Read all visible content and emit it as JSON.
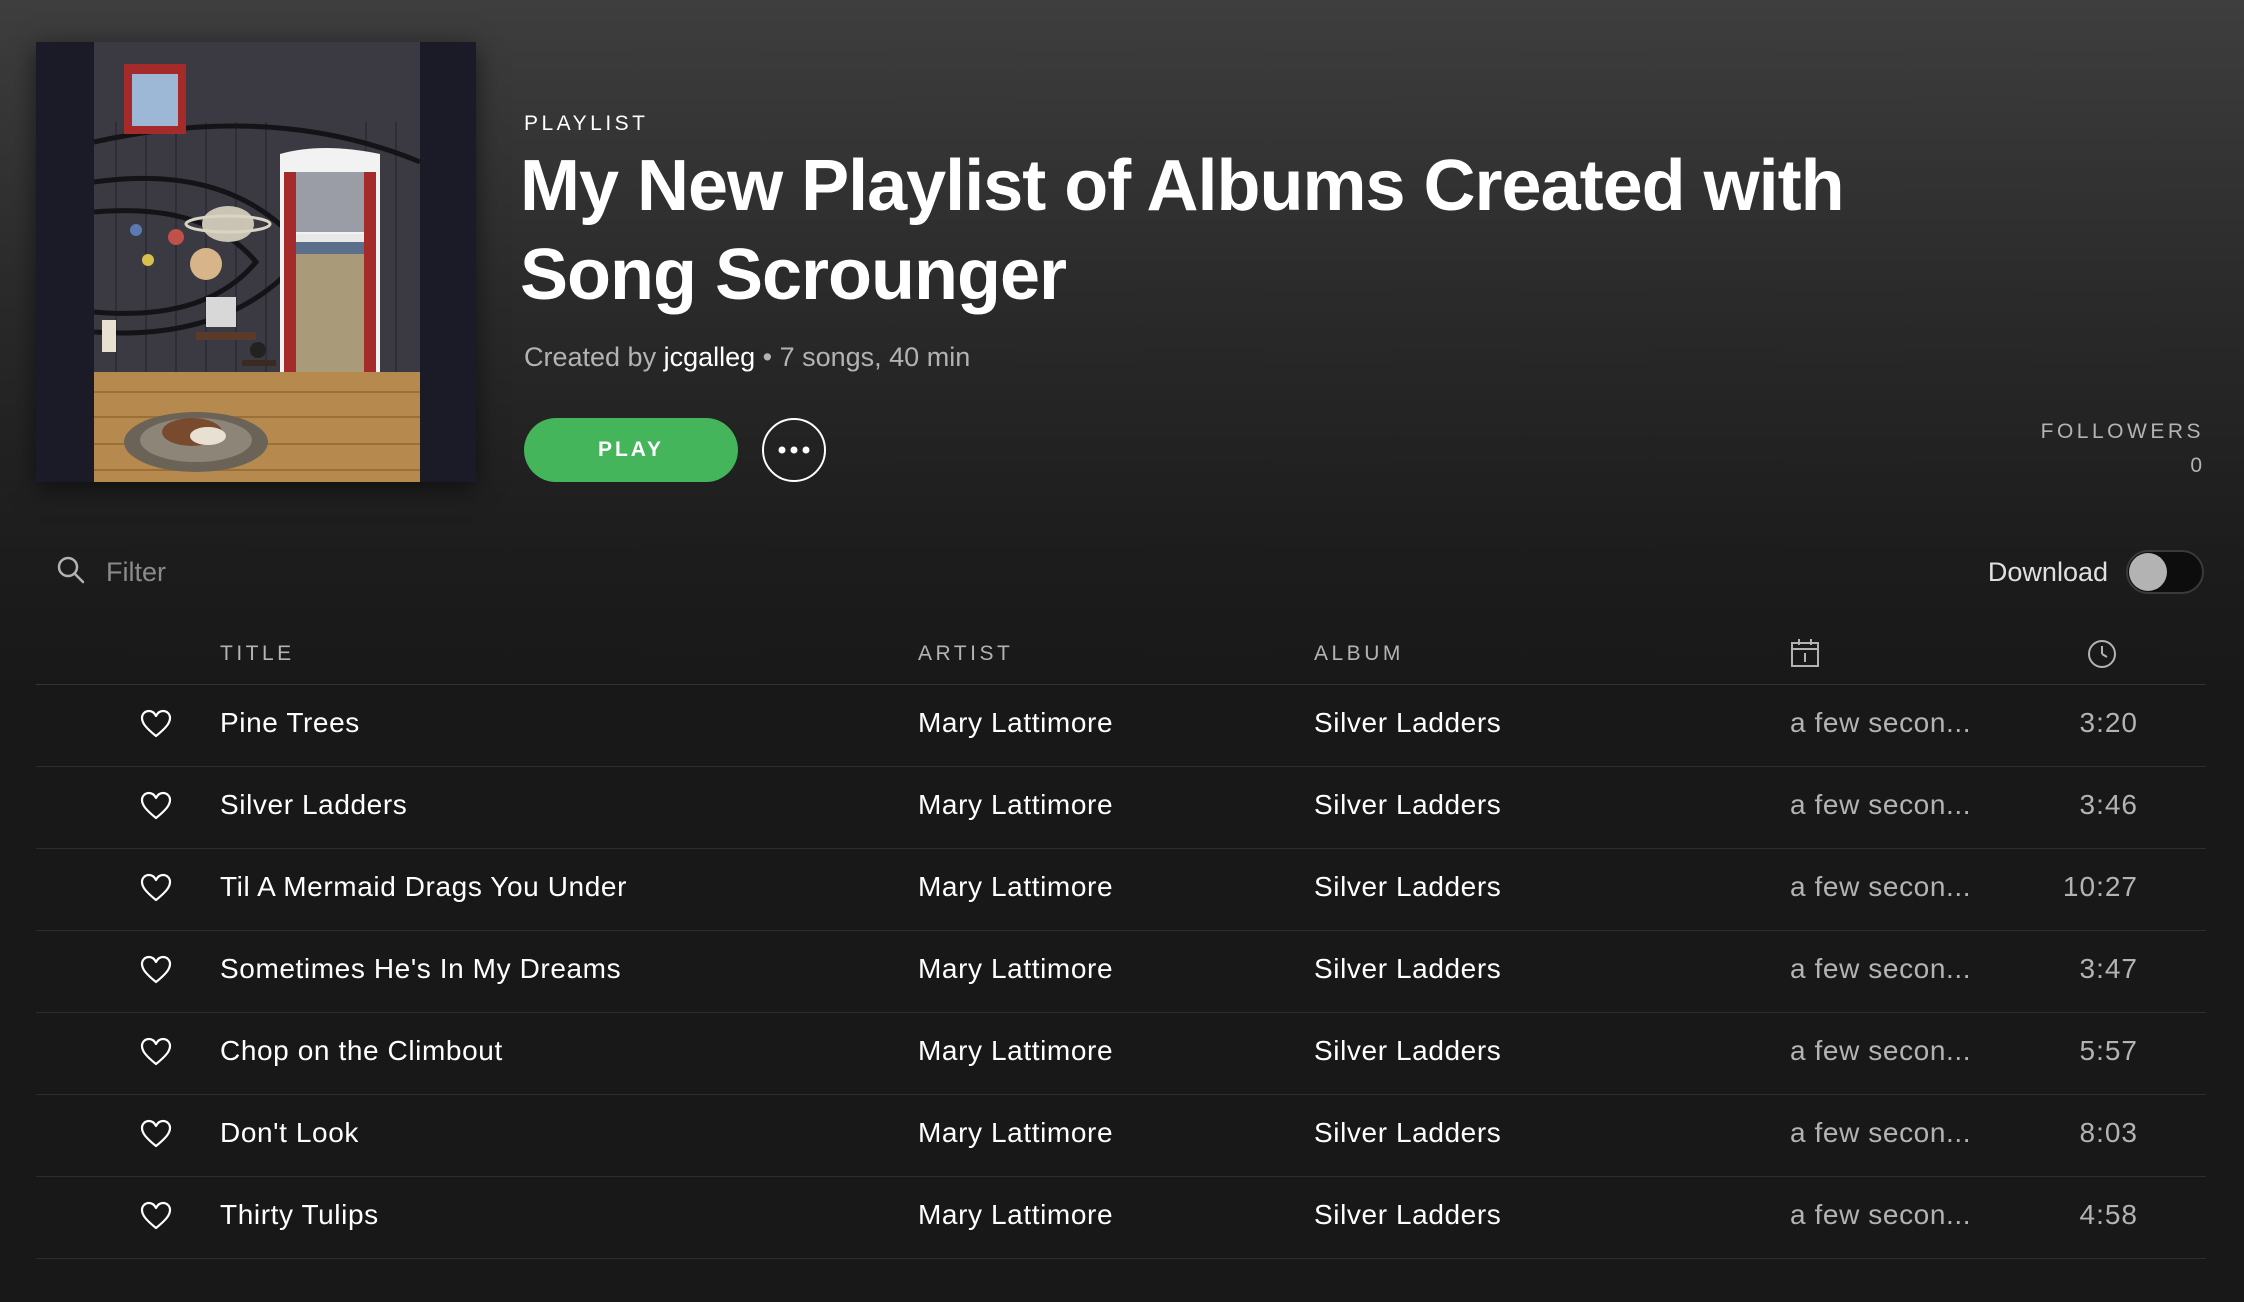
{
  "header": {
    "type_label": "PLAYLIST",
    "title": "My New Playlist of Albums Created with Song Scrounger",
    "meta_prefix": "Created by ",
    "owner": "jcgalleg",
    "meta_suffix": " • 7 songs, 40 min",
    "play_label": "PLAY",
    "followers_label": "FOLLOWERS",
    "followers_count": "0"
  },
  "filter": {
    "placeholder": "Filter"
  },
  "download": {
    "label": "Download",
    "enabled": false
  },
  "table": {
    "headers": {
      "title": "TITLE",
      "artist": "ARTIST",
      "album": "ALBUM",
      "added_icon": "calendar-icon",
      "duration_icon": "clock-icon"
    },
    "rows": [
      {
        "title": "Pine Trees",
        "artist": "Mary Lattimore",
        "album": "Silver Ladders",
        "added": "a few secon...",
        "duration": "3:20"
      },
      {
        "title": "Silver Ladders",
        "artist": "Mary Lattimore",
        "album": "Silver Ladders",
        "added": "a few secon...",
        "duration": "3:46"
      },
      {
        "title": "Til A Mermaid Drags You Under",
        "artist": "Mary Lattimore",
        "album": "Silver Ladders",
        "added": "a few secon...",
        "duration": "10:27"
      },
      {
        "title": "Sometimes He's In My Dreams",
        "artist": "Mary Lattimore",
        "album": "Silver Ladders",
        "added": "a few secon...",
        "duration": "3:47"
      },
      {
        "title": "Chop on the Climbout",
        "artist": "Mary Lattimore",
        "album": "Silver Ladders",
        "added": "a few secon...",
        "duration": "5:57"
      },
      {
        "title": "Don't Look",
        "artist": "Mary Lattimore",
        "album": "Silver Ladders",
        "added": "a few secon...",
        "duration": "8:03"
      },
      {
        "title": "Thirty Tulips",
        "artist": "Mary Lattimore",
        "album": "Silver Ladders",
        "added": "a few secon...",
        "duration": "4:58"
      }
    ]
  },
  "icons": {
    "search": "search-icon",
    "more": "more-dots-icon",
    "heart": "heart-icon"
  },
  "colors": {
    "accent": "#44b55a",
    "background": "#181818",
    "muted_text": "#b3b3b3"
  }
}
